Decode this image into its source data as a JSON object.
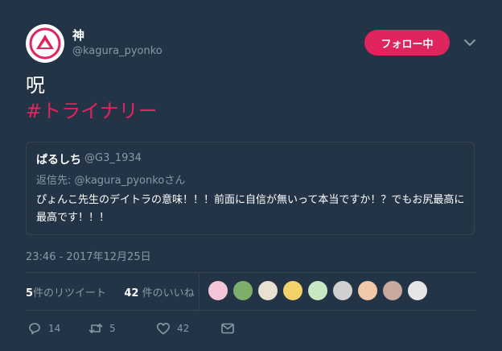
{
  "tweet": {
    "display_name": "神",
    "handle": "@kagura_pyonko",
    "follow_button": "フォロー中",
    "text_line1": "呪",
    "hashtag": "#トライナリー",
    "timestamp": "23:46 - 2017年12月25日"
  },
  "quoted": {
    "name": "ぱるしち",
    "handle": "@G3_1934",
    "reply_prefix": "返信先:",
    "reply_to": "@kagura_pyonkoさん",
    "text": "ぴょんこ先生のデイトラの意味！！！前面に自信が無いって本当ですか！？でもお尻最高に最高です！！！"
  },
  "stats": {
    "retweets_count": "5",
    "retweets_label": "件のリツイート",
    "likes_count": "42",
    "likes_label": "件のいいね"
  },
  "actions": {
    "reply_count": "14",
    "retweet_count": "5",
    "like_count": "42"
  },
  "icons": [
    "reply-icon",
    "retweet-icon",
    "like-icon",
    "dm-icon",
    "chevron-down-icon"
  ],
  "colors": {
    "background": "#243447",
    "accent": "#e0245e",
    "muted": "#8899a6",
    "border": "#38444d"
  },
  "liker_colors": [
    "#f4c6d7",
    "#7fae6a",
    "#e8e0d0",
    "#f2d36b",
    "#c9e7c2",
    "#d0d0d0",
    "#f1c9a8",
    "#c8a9a0",
    "#e6e6e6"
  ]
}
